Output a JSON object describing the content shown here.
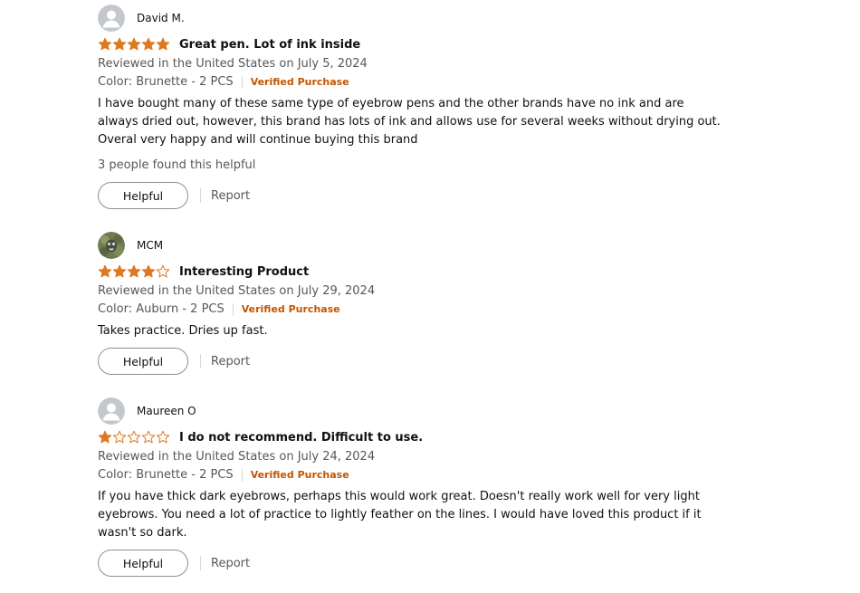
{
  "reviews": [
    {
      "reviewer": "David M.",
      "avatar": "default-avatar-icon",
      "rating": 5,
      "title": "Great pen. Lot of ink inside",
      "date": "Reviewed in the United States on July 5, 2024",
      "variant": "Color: Brunette - 2 PCS",
      "verified": "Verified Purchase",
      "body": "I have bought many of these same type of eyebrow pens and the other brands have no ink and are always dried out, however, this brand has lots of ink and allows use for several weeks without drying out. Overal very happy and will continue buying this brand",
      "helpful_count": "3 people found this helpful",
      "helpful_label": "Helpful",
      "report_label": "Report"
    },
    {
      "reviewer": "MCM",
      "avatar": "photo-avatar-icon",
      "rating": 4,
      "title": "Interesting Product",
      "date": "Reviewed in the United States on July 29, 2024",
      "variant": "Color: Auburn - 2 PCS",
      "verified": "Verified Purchase",
      "body": "Takes practice. Dries up fast.",
      "helpful_label": "Helpful",
      "report_label": "Report"
    },
    {
      "reviewer": "Maureen O",
      "avatar": "default-avatar-icon",
      "rating": 1,
      "title": "I do not recommend. Difficult to use.",
      "date": "Reviewed in the United States on July 24, 2024",
      "variant": "Color: Brunette - 2 PCS",
      "verified": "Verified Purchase",
      "body": "If you have thick dark eyebrows, perhaps this would work great. Doesn't really work well for very light eyebrows. You need a lot of practice to lightly feather on the lines. I would have loved this product if it wasn't so dark.",
      "helpful_label": "Helpful",
      "report_label": "Report"
    }
  ],
  "colors": {
    "star": "#de7921",
    "verified": "#c45500",
    "muted_text": "#565959"
  }
}
